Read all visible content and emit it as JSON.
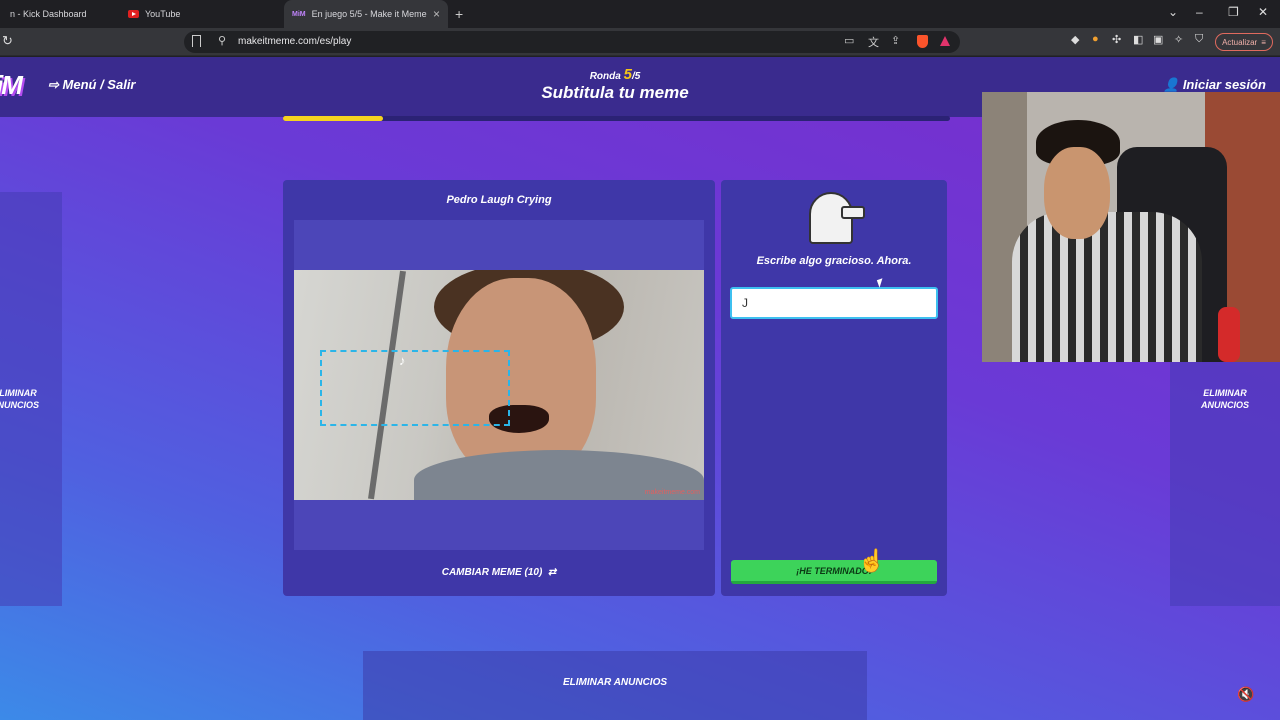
{
  "browser": {
    "tabs": [
      {
        "label": "n - Kick Dashboard",
        "icon": "kick-icon"
      },
      {
        "label": "YouTube",
        "icon": "youtube-icon"
      },
      {
        "label": "En juego 5/5 - Make it Meme",
        "icon": "makeitmeme-icon",
        "active": true
      }
    ],
    "url": "makeitmeme.com/es/play",
    "update_button": "Actualizar"
  },
  "nav": {
    "logo": "iM",
    "menu_label": "Menú / Salir",
    "round_label": "Ronda",
    "round_current": "5",
    "round_total": "/5",
    "title": "Subtitula tu meme",
    "login_label": "Iniciar sesión",
    "round_progress": 0.15
  },
  "meme": {
    "name": "Pedro Laugh Crying",
    "watermark": "makeitmeme.com",
    "change_label": "CAMBIAR MEME (10)"
  },
  "editor": {
    "prompt": "Escribe algo gracioso. Ahora.",
    "input_value": "J",
    "done_label": "¡HE TERMINADO!"
  },
  "ads": {
    "left": "ELIMINAR ANUNCIOS",
    "right": "ELIMINAR ANUNCIOS",
    "bottom": "ELIMINAR ANUNCIOS"
  },
  "colors": {
    "accent_yellow": "#f5d31f",
    "done_green": "#3dd35a",
    "panel": "#3f37a8",
    "caption_box": "#2bb5e8"
  }
}
